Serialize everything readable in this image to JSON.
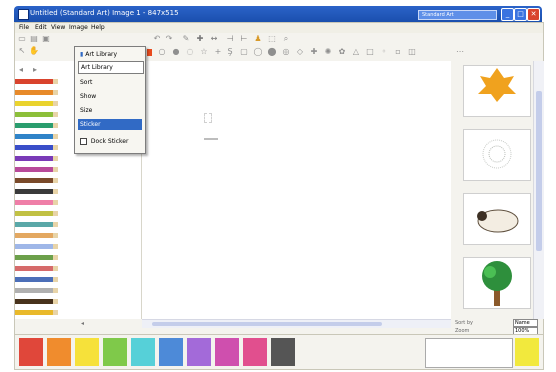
{
  "window": {
    "title": "Untitled (Standard Art) Image 1 - 847x515",
    "header_combo": "Standard Art"
  },
  "menu": [
    {
      "label": "File"
    },
    {
      "label": "Edit"
    },
    {
      "label": "View"
    },
    {
      "label": "Image"
    },
    {
      "label": "Help"
    }
  ],
  "dropdown": {
    "items": [
      {
        "label": "Art Library",
        "active": false
      },
      {
        "label": "Art Library",
        "active": false
      },
      {
        "label": "Sort",
        "active": false
      },
      {
        "label": "Show",
        "active": false
      },
      {
        "label": "Size",
        "active": false
      },
      {
        "label": "Sticker",
        "active": true
      }
    ],
    "checkbox_label": "Dock Sticker"
  },
  "right_controls": {
    "label_1": "Sort by",
    "value_1": "Name",
    "label_2": "Zoom",
    "value_2": "100%"
  },
  "colors": {
    "title_bar": "#1a4fae",
    "highlight": "#316ac5"
  },
  "pencils": [
    "#d9432d",
    "#e78a2a",
    "#ead32e",
    "#8cbf3a",
    "#2a9d6e",
    "#2f83c8",
    "#3a4ec9",
    "#7a3ab7",
    "#b84a9a",
    "#7a4a2a",
    "#3a3a3a",
    "#ef7fa8",
    "#c1c144",
    "#5aa8a8",
    "#e3a861",
    "#9fb7e8",
    "#6ca04a",
    "#d66a6a",
    "#4c6fb8",
    "#b0b0b0",
    "#48321c",
    "#e9b92b"
  ],
  "palette": [
    "#e0473a",
    "#f08c2d",
    "#f6e13a",
    "#7fc94a",
    "#56d0d8",
    "#4d8ad8",
    "#a36ad9",
    "#cf4fae",
    "#e14f8e",
    "#555555",
    "#f2e93d"
  ],
  "gallery": [
    {
      "name": "sun-stamp-icon"
    },
    {
      "name": "dandelion-stamp-icon"
    },
    {
      "name": "sheep-stamp-icon"
    },
    {
      "name": "tree-stamp-icon"
    }
  ]
}
